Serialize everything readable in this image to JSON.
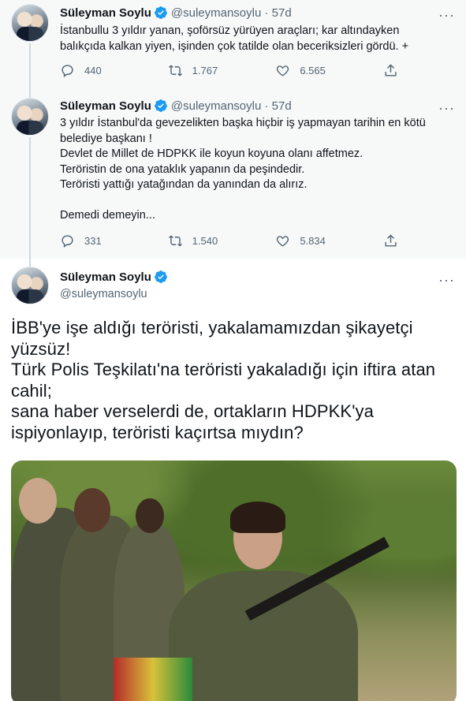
{
  "author": {
    "name": "Süleyman Soylu",
    "handle": "@suleymansoylu",
    "verified": true
  },
  "thread": [
    {
      "time": "57d",
      "lines": [
        "İstanbullu 3 yıldır yanan, şoförsüz yürüyen araçları; kar altındayken",
        "balıkçıda kalkan yiyen, işinden çok tatilde olan beceriksizleri gördü. +"
      ],
      "replies": "440",
      "retweets": "1.767",
      "likes": "6.565"
    },
    {
      "time": "57d",
      "lines": [
        "3 yıldır İstanbul'da gevezelikten başka hiçbir iş yapmayan tarihin en kötü",
        "belediye başkanı !",
        "Devlet de Millet de HDPKK ile koyun koyuna olanı affetmez.",
        "Teröristin de ona yataklık yapanın da peşindedir.",
        "Teröristi yattığı yatağından da yanından da alırız.",
        "",
        "Demedi demeyin..."
      ],
      "replies": "331",
      "retweets": "1.540",
      "likes": "5.834"
    }
  ],
  "main_tweet": {
    "lines": [
      "İBB'ye işe aldığı teröristi, yakalamamızdan şikayetçi",
      "yüzsüz!",
      "Türk Polis Teşkilatı'na teröristi yakaladığı için iftira atan",
      "cahil;",
      "sana haber verselerdi de, ortakların HDPKK'ya",
      "ispiyonlayıp, teröristi kaçırtsa mıydın?"
    ]
  },
  "icons": {
    "verified": "verified-badge-icon",
    "more": "more-dots-icon",
    "reply": "reply-icon",
    "retweet": "retweet-icon",
    "like": "heart-icon",
    "share": "share-icon"
  },
  "colors": {
    "verified_blue": "#1d9bf0",
    "thread_bg": "#f7f9f9",
    "secondary_text": "#536471"
  }
}
